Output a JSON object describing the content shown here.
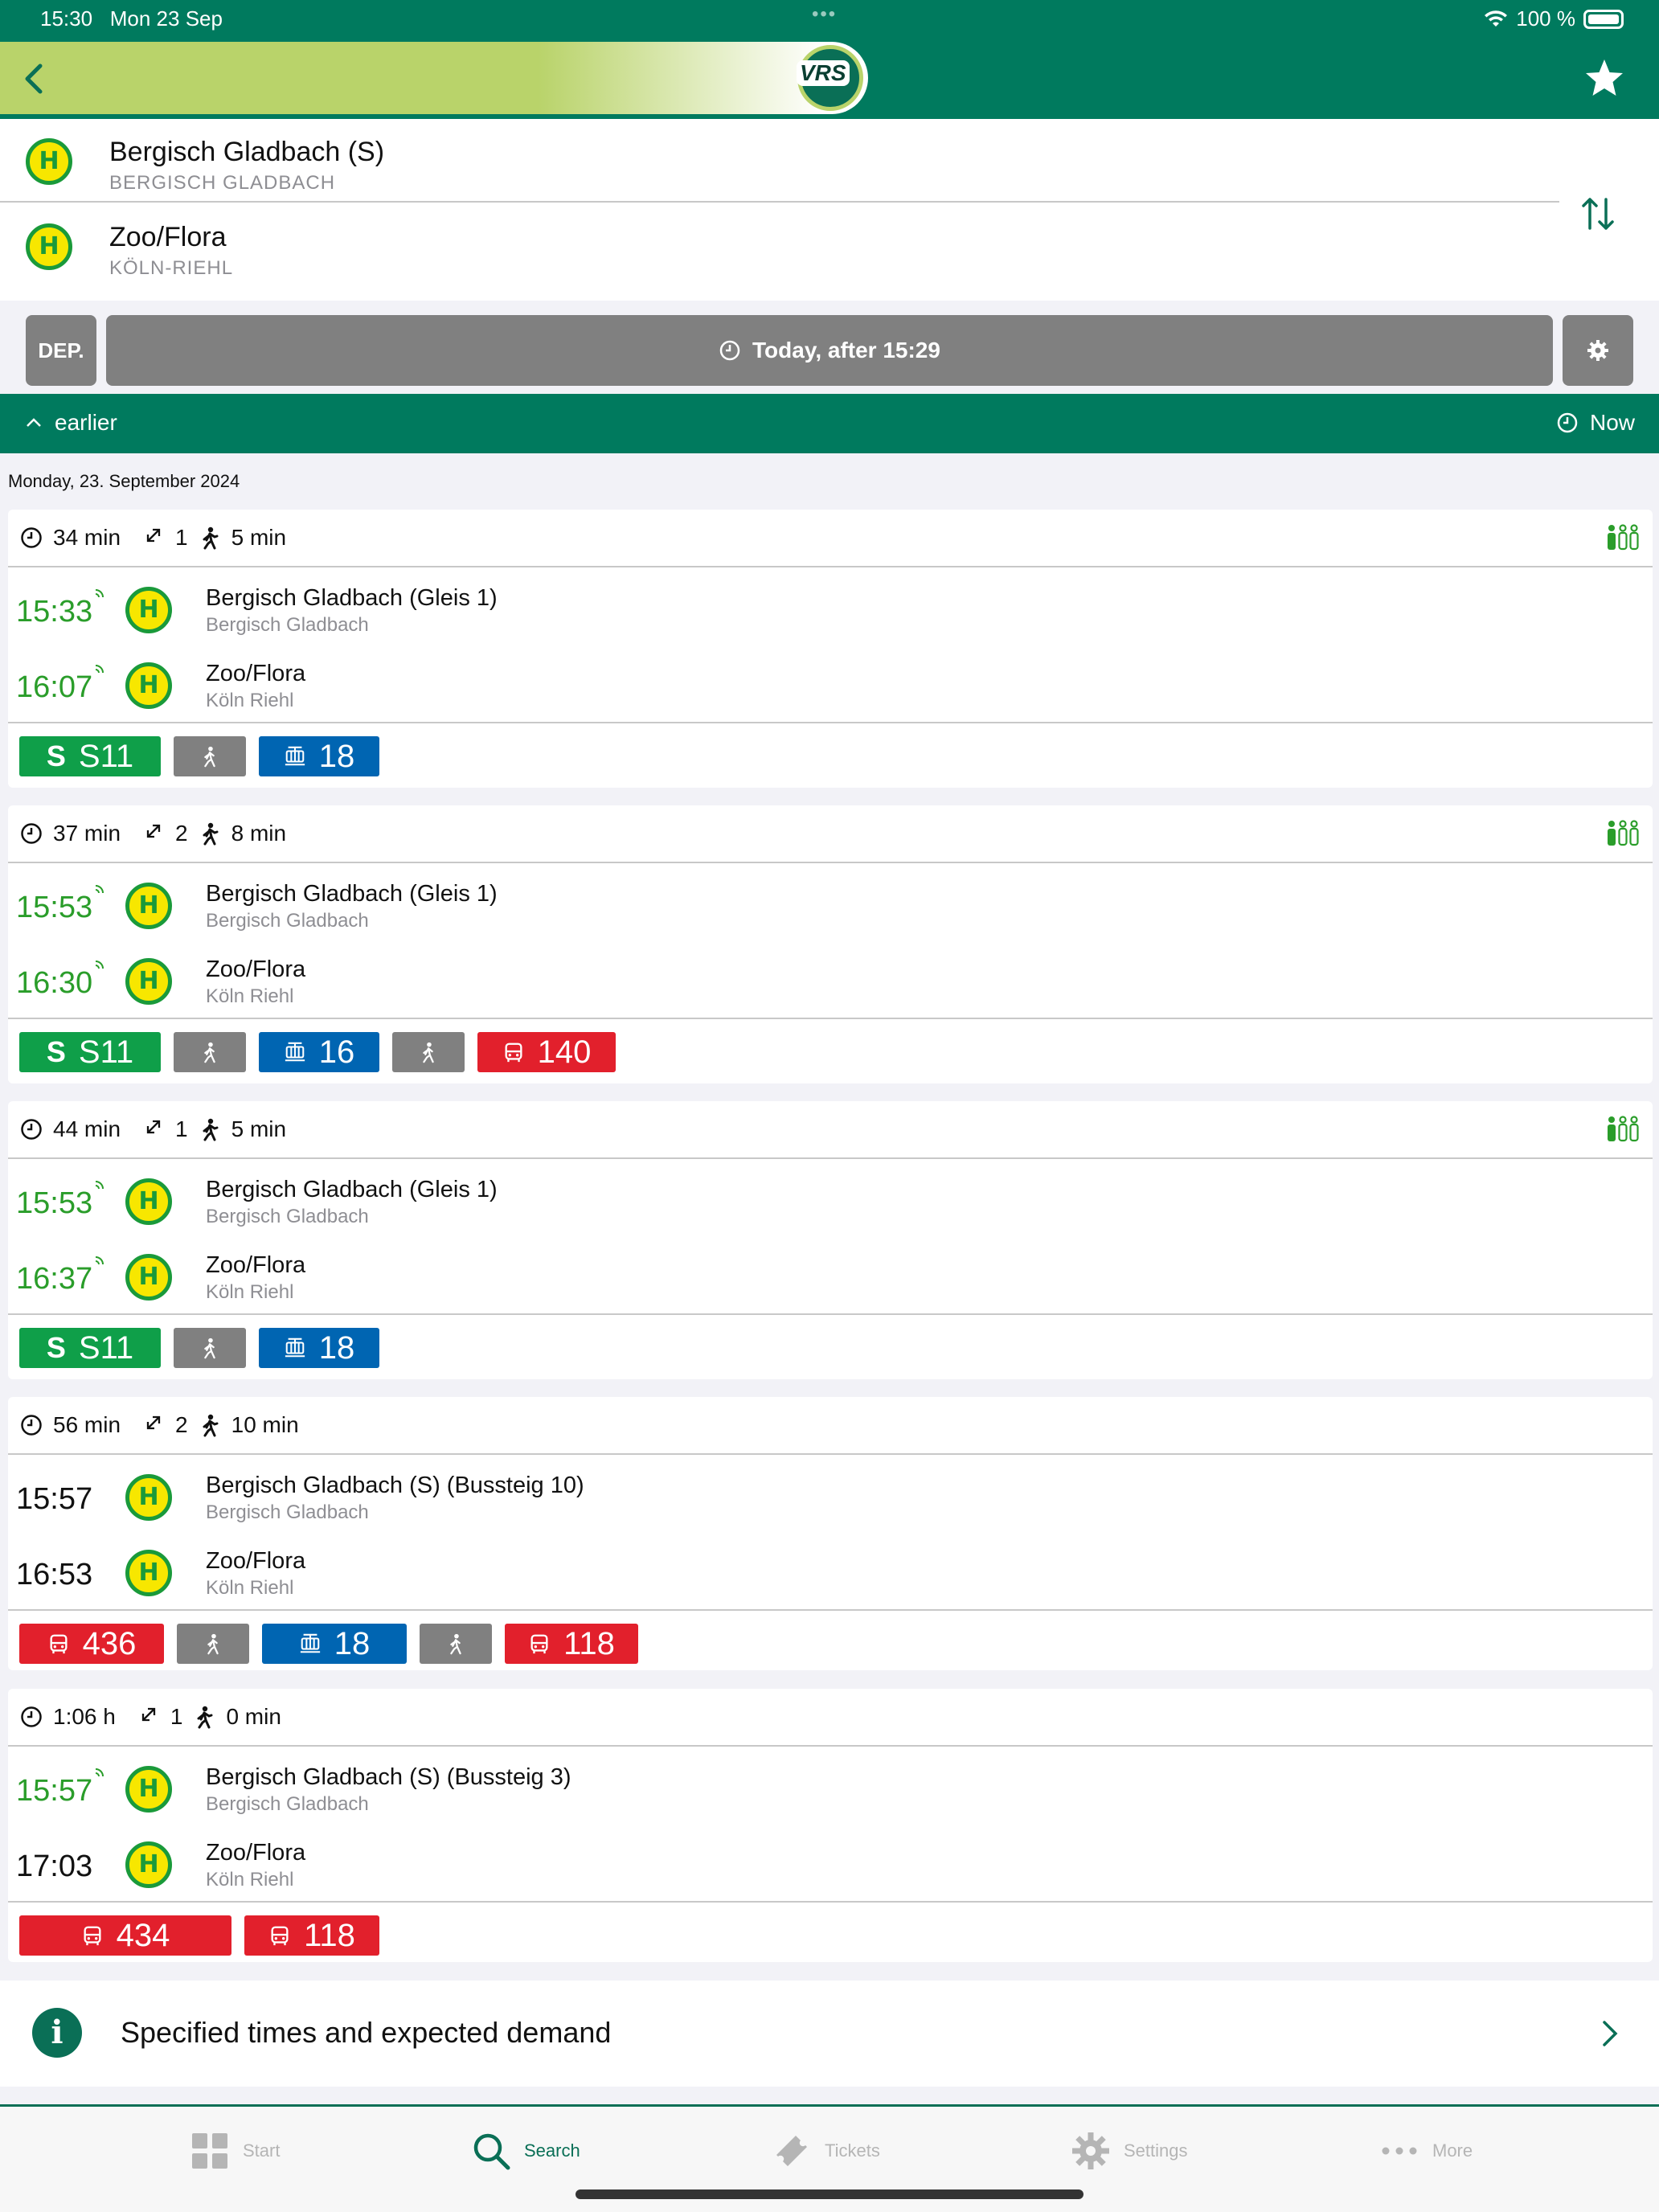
{
  "status_bar": {
    "time": "15:30",
    "date": "Mon 23 Sep",
    "battery": "100 %"
  },
  "header": {
    "logo_text": "VRS"
  },
  "route": {
    "from": {
      "name": "Bergisch Gladbach (S)",
      "city": "BERGISCH GLADBACH"
    },
    "to": {
      "name": "Zoo/Flora",
      "city": "KÖLN-RIEHL"
    },
    "stop_symbol": "H"
  },
  "controls": {
    "mode_label": "DEP.",
    "time_label": "Today, after 15:29"
  },
  "earlier_bar": {
    "earlier_label": "earlier",
    "now_label": "Now"
  },
  "date_heading": "Monday, 23. September 2024",
  "connections": [
    {
      "duration": "34 min",
      "changes": "1",
      "walk": "5 min",
      "dep_time": "15:33",
      "dep_stop": "Bergisch Gladbach (Gleis 1)",
      "dep_city": "Bergisch Gladbach",
      "arr_time": "16:07",
      "arr_stop": "Zoo/Flora",
      "arr_city": "Köln Riehl",
      "lines": [
        {
          "type": "s",
          "letter": "S",
          "label": "S11"
        },
        {
          "type": "walk",
          "label": ""
        },
        {
          "type": "tram",
          "label": "18"
        }
      ]
    },
    {
      "duration": "37 min",
      "changes": "2",
      "walk": "8 min",
      "dep_time": "15:53",
      "dep_stop": "Bergisch Gladbach (Gleis 1)",
      "dep_city": "Bergisch Gladbach",
      "arr_time": "16:30",
      "arr_stop": "Zoo/Flora",
      "arr_city": "Köln Riehl",
      "lines": [
        {
          "type": "s",
          "letter": "S",
          "label": "S11"
        },
        {
          "type": "walk",
          "label": ""
        },
        {
          "type": "tram",
          "label": "16"
        },
        {
          "type": "walk",
          "label": ""
        },
        {
          "type": "bus",
          "label": "140"
        }
      ]
    },
    {
      "duration": "44 min",
      "changes": "1",
      "walk": "5 min",
      "dep_time": "15:53",
      "dep_stop": "Bergisch Gladbach (Gleis 1)",
      "dep_city": "Bergisch Gladbach",
      "arr_time": "16:37",
      "arr_stop": "Zoo/Flora",
      "arr_city": "Köln Riehl",
      "lines": [
        {
          "type": "s",
          "letter": "S",
          "label": "S11"
        },
        {
          "type": "walk",
          "label": ""
        },
        {
          "type": "tram",
          "label": "18"
        }
      ]
    },
    {
      "duration": "56 min",
      "changes": "2",
      "walk": "10 min",
      "dep_time": "15:57",
      "dep_stop": "Bergisch Gladbach (S) (Bussteig 10)",
      "dep_city": "Bergisch Gladbach",
      "arr_time": "16:53",
      "arr_stop": "Zoo/Flora",
      "arr_city": "Köln Riehl",
      "lines": [
        {
          "type": "bus",
          "label": "436"
        },
        {
          "type": "walk",
          "label": ""
        },
        {
          "type": "tram",
          "label": "18"
        },
        {
          "type": "walk",
          "label": ""
        },
        {
          "type": "bus",
          "label": "118"
        }
      ]
    },
    {
      "duration": "1:06 h",
      "changes": "1",
      "walk": "0 min",
      "dep_time": "15:57",
      "dep_stop": "Bergisch Gladbach (S) (Bussteig 3)",
      "dep_city": "Bergisch Gladbach",
      "arr_time": "17:03",
      "arr_stop": "Zoo/Flora",
      "arr_city": "Köln Riehl",
      "lines": [
        {
          "type": "bus",
          "label": "434"
        },
        {
          "type": "bus",
          "label": "118"
        }
      ]
    }
  ],
  "info_row": {
    "icon_letter": "i",
    "text": "Specified times and expected demand"
  },
  "tabs": [
    {
      "label": "Start",
      "icon": "grid-icon"
    },
    {
      "label": "Search",
      "icon": "search-icon"
    },
    {
      "label": "Tickets",
      "icon": "ticket-icon"
    },
    {
      "label": "Settings",
      "icon": "gear-icon"
    },
    {
      "label": "More",
      "icon": "more-dots-icon"
    }
  ],
  "colors": {
    "primary": "#007a5e",
    "realtime": "#2a9d2a",
    "s_bahn": "#0f9f49",
    "tram": "#0065b2",
    "bus": "#e2202c",
    "walk": "#808080"
  }
}
